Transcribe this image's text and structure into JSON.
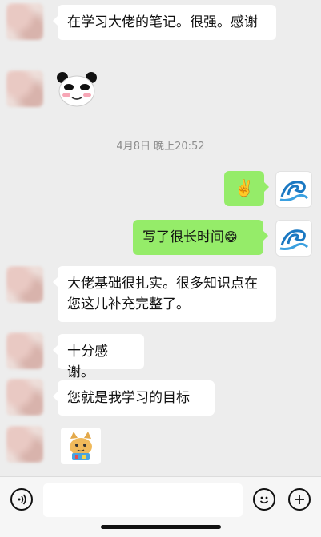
{
  "messages": [
    {
      "text": "在学习大佬的笔记。很强。感谢"
    },
    {
      "text": "大佬基础很扎实。很多知识点在您这儿补充完整了。"
    },
    {
      "text": "十分感谢。"
    },
    {
      "text": "您就是我学习的目标"
    },
    {
      "text": "写了很长时间"
    }
  ],
  "timestamp": "4月8日 晚上20:52",
  "emoji": {
    "victory": "✌️",
    "grin": "😁"
  },
  "icons": {
    "voice": "voice-icon",
    "emoji": "emoji-icon",
    "add": "plus-icon",
    "avatar_self": "wave-avatar"
  },
  "colors": {
    "incoming": "#ffffff",
    "outgoing": "#95ec69",
    "background": "#ededed"
  }
}
